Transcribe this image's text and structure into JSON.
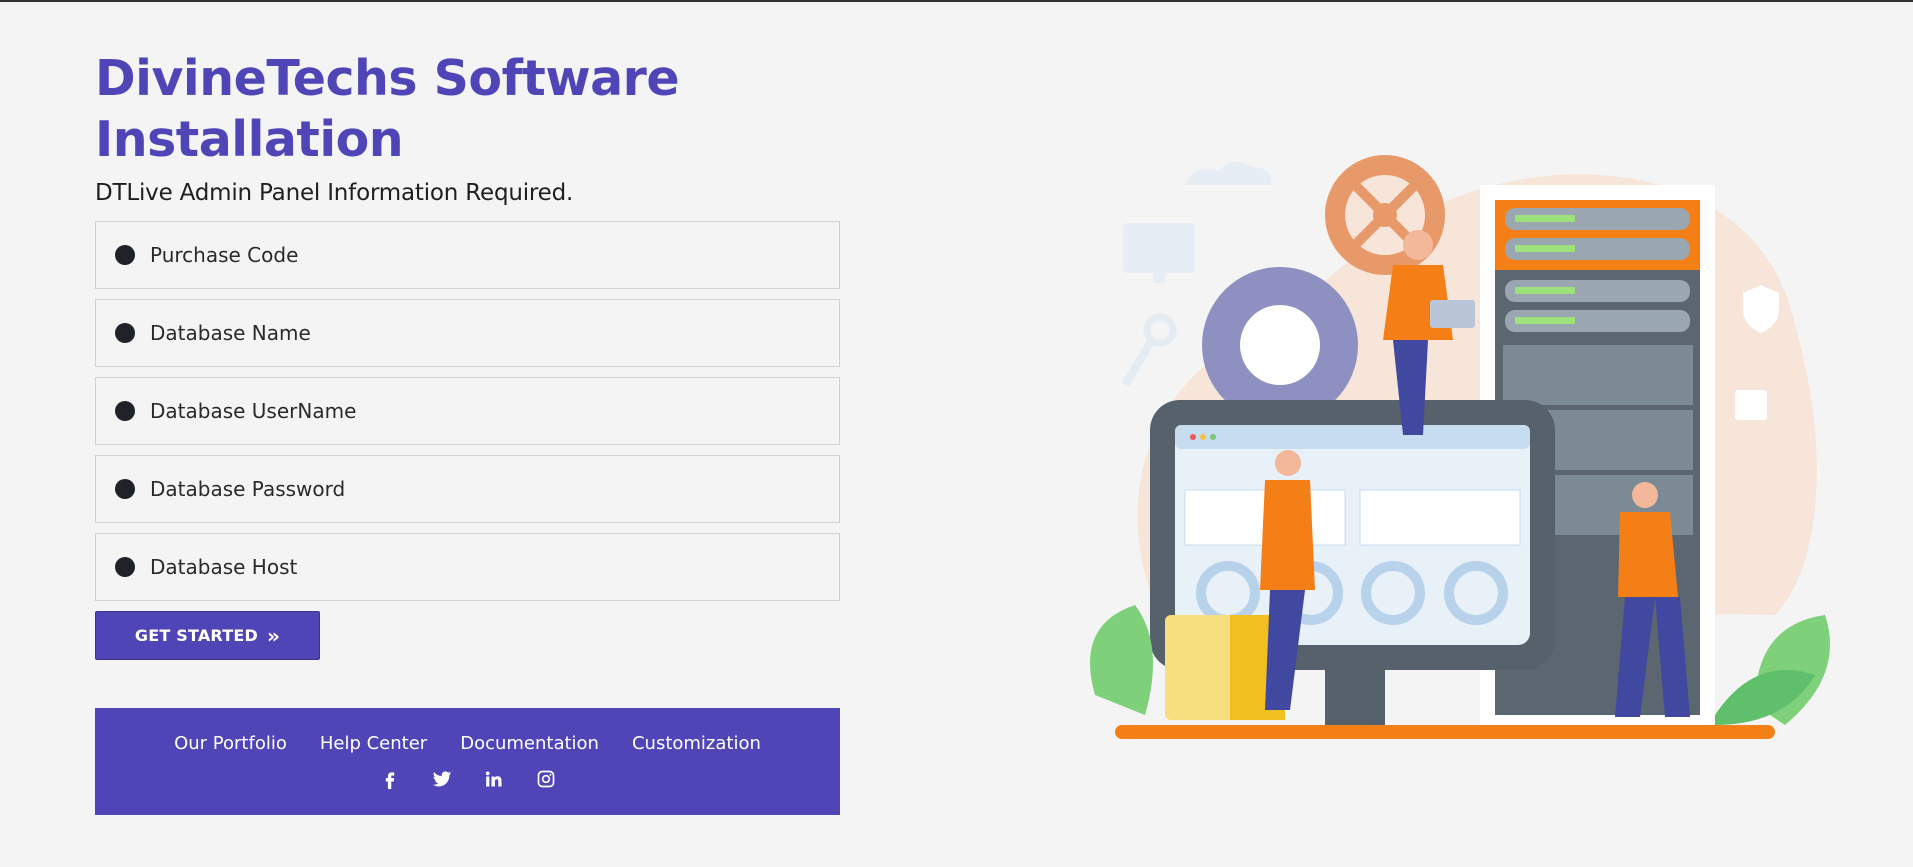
{
  "page": {
    "title": "DivineTechs Software Installation",
    "subtitle": "DTLive Admin Panel Information Required."
  },
  "fields": [
    {
      "label": "Purchase Code"
    },
    {
      "label": "Database Name"
    },
    {
      "label": "Database UserName"
    },
    {
      "label": "Database Password"
    },
    {
      "label": "Database Host"
    }
  ],
  "button": {
    "label": "GET STARTED",
    "icon": "double-chevron-right-icon"
  },
  "footer": {
    "links": [
      "Our Portfolio",
      "Help Center",
      "Documentation",
      "Customization"
    ],
    "socials": [
      "facebook-icon",
      "twitter-icon",
      "linkedin-icon",
      "instagram-icon"
    ]
  },
  "colors": {
    "brand": "#4f45b7",
    "orange": "#f57f17",
    "background": "#f4f4f4"
  }
}
